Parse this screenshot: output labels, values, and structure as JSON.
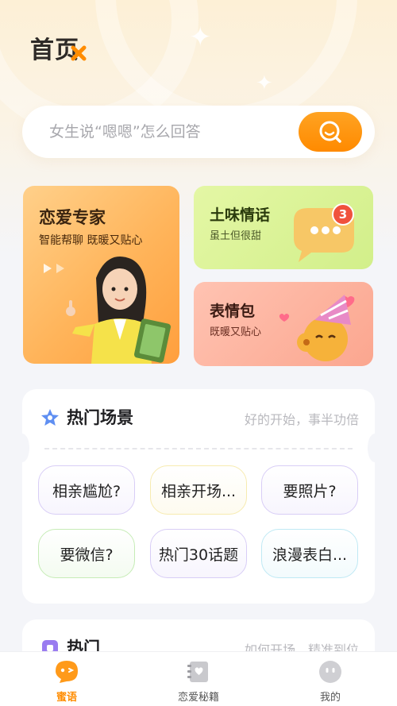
{
  "header": {
    "title": "首页"
  },
  "search": {
    "placeholder": "女生说“嗯嗯”怎么回答"
  },
  "cards": {
    "expert": {
      "title": "恋爱专家",
      "subtitle": "智能帮聊 既暖又贴心"
    },
    "love_words": {
      "title": "土味情话",
      "subtitle": "虽土但很甜",
      "badge": "3"
    },
    "emoji": {
      "title": "表情包",
      "subtitle": "既暖又贴心"
    }
  },
  "hot_scenes": {
    "title": "热门场景",
    "subtitle": "好的开始，事半功倍",
    "chips": [
      {
        "label": "相亲尴尬?",
        "color": "#d8cdf6"
      },
      {
        "label": "相亲开场...",
        "color": "#f7ebb0"
      },
      {
        "label": "要照片?",
        "color": "#d8cdf6"
      },
      {
        "label": "要微信?",
        "color": "#c6ecb6"
      },
      {
        "label": "热门30话题",
        "color": "#d8cdf6"
      },
      {
        "label": "浪漫表白...",
        "color": "#bfe9f4"
      }
    ]
  },
  "hot": {
    "title": "热门",
    "subtitle": "如何开场，精准到位"
  },
  "tabbar": {
    "items": [
      {
        "label": "蜜语",
        "active": true
      },
      {
        "label": "恋爱秘籍",
        "active": false
      },
      {
        "label": "我的",
        "active": false
      }
    ]
  },
  "colors": {
    "accent": "#ff8c00",
    "active_tab": "#ff8c00",
    "inactive_tab": "#555555"
  }
}
